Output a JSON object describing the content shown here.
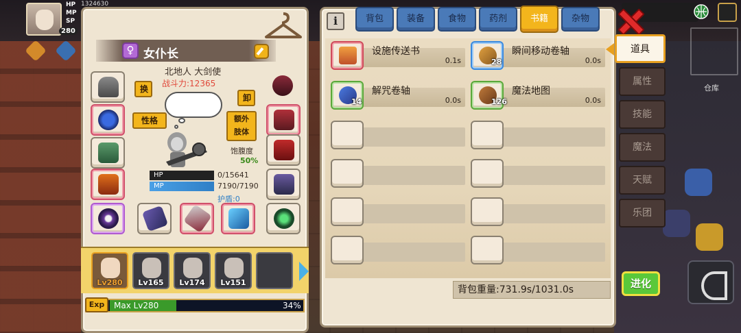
{
  "hero_hud": {
    "hp_tag": "HP",
    "mp_tag": "MP",
    "sp_tag": "SP",
    "hp_value": "1324630",
    "level": "280"
  },
  "side_labels": {
    "warehouse": "仓库"
  },
  "character": {
    "name": "女仆长",
    "gender_symbol": "♀",
    "origin": "北地人 大剑使",
    "power": "战斗力:12365",
    "swap_label": "换",
    "unequip_label": "卸",
    "trait_label": "性格",
    "extra_limb_label": "额外\n肢体",
    "satiety_label": "饱腹度",
    "satiety_value": "50%",
    "satiety_fraction": 0.5,
    "hp_label": "HP",
    "mp_label": "MP",
    "hp_text": "0/15641",
    "mp_text": "7190/7190",
    "hp_fraction": 0.0,
    "mp_fraction": 1.0,
    "shield_text": "护盾:0"
  },
  "party": [
    {
      "level": "Lv280",
      "active": true
    },
    {
      "level": "Lv165",
      "active": false
    },
    {
      "level": "Lv174",
      "active": false
    },
    {
      "level": "Lv151",
      "active": false
    }
  ],
  "exp": {
    "tag": "Exp",
    "text": "Max Lv280",
    "percent": "34%",
    "fraction": 0.34
  },
  "inventory": {
    "tabs": [
      "背包",
      "装备",
      "食物",
      "药剂",
      "书籍",
      "杂物"
    ],
    "active_tab": "书籍",
    "items": [
      {
        "name": "设施传送书",
        "time": "0.1s",
        "count": ""
      },
      {
        "name": "瞬间移动卷轴",
        "time": "0.0s",
        "count": "28"
      },
      {
        "name": "解咒卷轴",
        "time": "0.0s",
        "count": "14"
      },
      {
        "name": "魔法地图",
        "time": "0.0s",
        "count": "126"
      }
    ],
    "weight": "背包重量:731.9s/1031.0s"
  },
  "side_tabs": [
    "道具",
    "属性",
    "技能",
    "魔法",
    "天赋",
    "乐团"
  ],
  "evolve_label": "进化",
  "colors": {
    "accent_gold": "#f3b51c",
    "tab_blue": "#4a7ab8",
    "panel_bg": "#efe5d2",
    "hp_red": "#e0483a",
    "evolve_green": "#5ac83a"
  }
}
